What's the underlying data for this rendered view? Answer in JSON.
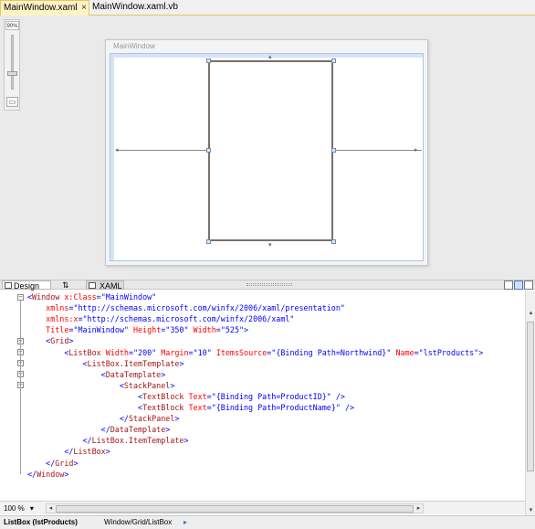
{
  "tabs": [
    {
      "label": "MainWindow.xaml",
      "active": true,
      "close": "×"
    },
    {
      "label": "MainWindow.xaml.vb",
      "active": false
    }
  ],
  "designer": {
    "zoom_label": "90%",
    "window_title": "MainWindow"
  },
  "split": {
    "design_tab": "Design",
    "swap_symbol": "⇅",
    "xaml_tab": "XAML"
  },
  "code_lines": [
    [
      [
        "<",
        "b"
      ],
      [
        "Window",
        "n"
      ],
      [
        " x:Class",
        "a"
      ],
      [
        "=",
        "b"
      ],
      [
        "\"MainWindow\"",
        "v"
      ]
    ],
    [
      [
        "    xmlns",
        "a"
      ],
      [
        "=",
        "b"
      ],
      [
        "\"http://schemas.microsoft.com/winfx/2006/xaml/presentation\"",
        "v"
      ]
    ],
    [
      [
        "    xmlns:x",
        "a"
      ],
      [
        "=",
        "b"
      ],
      [
        "\"http://schemas.microsoft.com/winfx/2006/xaml\"",
        "v"
      ]
    ],
    [
      [
        "    Title",
        "a"
      ],
      [
        "=",
        "b"
      ],
      [
        "\"MainWindow\"",
        "v"
      ],
      [
        " Height",
        "a"
      ],
      [
        "=",
        "b"
      ],
      [
        "\"350\"",
        "v"
      ],
      [
        " Width",
        "a"
      ],
      [
        "=",
        "b"
      ],
      [
        "\"525\"",
        "v"
      ],
      [
        ">",
        "b"
      ]
    ],
    [
      [
        "    <",
        "b"
      ],
      [
        "Grid",
        "n"
      ],
      [
        ">",
        "b"
      ]
    ],
    [
      [
        "        <",
        "b"
      ],
      [
        "ListBox",
        "n"
      ],
      [
        " Width",
        "a"
      ],
      [
        "=",
        "b"
      ],
      [
        "\"200\"",
        "v"
      ],
      [
        " Margin",
        "a"
      ],
      [
        "=",
        "b"
      ],
      [
        "\"10\"",
        "v"
      ],
      [
        " ItemsSource",
        "a"
      ],
      [
        "=",
        "b"
      ],
      [
        "\"{Binding Path=Northwind}\"",
        "v"
      ],
      [
        " Name",
        "a"
      ],
      [
        "=",
        "b"
      ],
      [
        "\"lstProducts\"",
        "v"
      ],
      [
        ">",
        "b"
      ]
    ],
    [
      [
        "            <",
        "b"
      ],
      [
        "ListBox.ItemTemplate",
        "n"
      ],
      [
        ">",
        "b"
      ]
    ],
    [
      [
        "                <",
        "b"
      ],
      [
        "DataTemplate",
        "n"
      ],
      [
        ">",
        "b"
      ]
    ],
    [
      [
        "                    <",
        "b"
      ],
      [
        "StackPanel",
        "n"
      ],
      [
        ">",
        "b"
      ]
    ],
    [
      [
        "                        <",
        "b"
      ],
      [
        "TextBlock",
        "n"
      ],
      [
        " Text",
        "a"
      ],
      [
        "=",
        "b"
      ],
      [
        "\"{Binding Path=ProductID}\"",
        "v"
      ],
      [
        " />",
        "b"
      ]
    ],
    [
      [
        "                        <",
        "b"
      ],
      [
        "TextBlock",
        "n"
      ],
      [
        " Text",
        "a"
      ],
      [
        "=",
        "b"
      ],
      [
        "\"{Binding Path=ProductName}\"",
        "v"
      ],
      [
        " />",
        "b"
      ]
    ],
    [
      [
        "                    </",
        "b"
      ],
      [
        "StackPanel",
        "n"
      ],
      [
        ">",
        "b"
      ]
    ],
    [
      [
        "                </",
        "b"
      ],
      [
        "DataTemplate",
        "n"
      ],
      [
        ">",
        "b"
      ]
    ],
    [
      [
        "            </",
        "b"
      ],
      [
        "ListBox.ItemTemplate",
        "n"
      ],
      [
        ">",
        "b"
      ]
    ],
    [
      [
        "        </",
        "b"
      ],
      [
        "ListBox",
        "n"
      ],
      [
        ">",
        "b"
      ]
    ],
    [
      [
        "    </",
        "b"
      ],
      [
        "Grid",
        "n"
      ],
      [
        ">",
        "b"
      ]
    ],
    [
      [
        "</",
        "b"
      ],
      [
        "Window",
        "n"
      ],
      [
        ">",
        "b"
      ]
    ]
  ],
  "folds": [
    {
      "line": 0,
      "symbol": "−"
    },
    {
      "line": 4,
      "symbol": "−"
    },
    {
      "line": 5,
      "symbol": "−"
    },
    {
      "line": 6,
      "symbol": "−"
    },
    {
      "line": 7,
      "symbol": "−"
    },
    {
      "line": 8,
      "symbol": "−"
    }
  ],
  "editor": {
    "zoom": "100 %",
    "zoom_caret": "▾"
  },
  "status": {
    "selected": "ListBox (lstProducts)",
    "path": "Window/Grid/ListBox",
    "nav_arrow": "▸"
  },
  "colors": {
    "keyword": "#0000ff",
    "element": "#a31515",
    "attribute": "#ff0000",
    "value": "#0000ff",
    "active_tab": "#fff3c5"
  }
}
